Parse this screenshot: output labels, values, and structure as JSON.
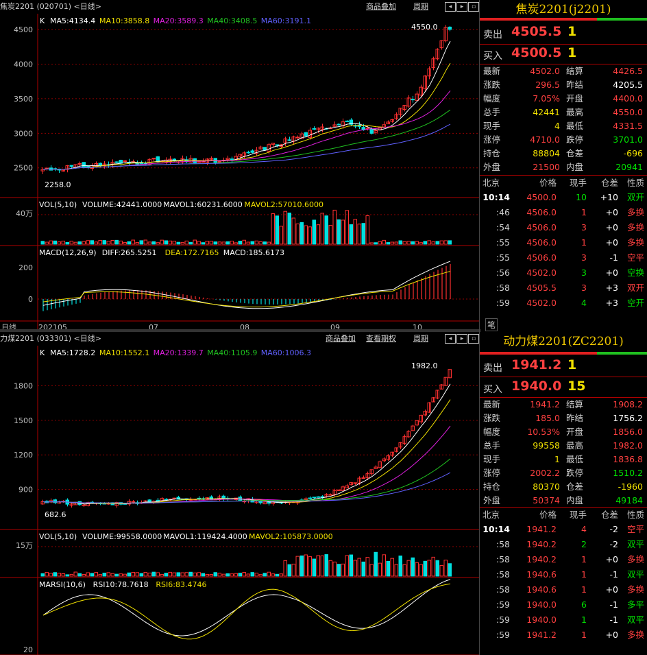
{
  "charts": [
    {
      "title": "焦炭2201 (020701) <日线>",
      "links": [
        "商品叠加",
        "周期"
      ],
      "k": {
        "label": "K",
        "ma5": "MA5:4134.4",
        "ma10": "MA10:3858.8",
        "ma20": "MA20:3589.3",
        "ma40": "MA40:3408.5",
        "ma60": "MA60:3191.1",
        "yticks": [
          "4500",
          "4000",
          "3500",
          "3000",
          "2500"
        ],
        "max_label": "4550.0",
        "min_label": "2258.0",
        "ymin": 2150,
        "ymax": 4650,
        "start": 2480,
        "end": 4550,
        "low": 2258,
        "high": 4550,
        "mamult": [
          0.97,
          0.92,
          0.86,
          0.8,
          0.75
        ]
      },
      "vol": {
        "label": "VOL(5,10)",
        "v": "VOLUME:42441.0000",
        "m1": "MAVOL1:60231.6000",
        "m2": "MAVOL2:57010.6000",
        "ytick": "40万"
      },
      "ind": {
        "label": "MACD(12,26,9)",
        "a": "DIFF:265.5251",
        "b": "DEA:172.7165",
        "c": "MACD:185.6173",
        "yticks": [
          "200",
          "0"
        ]
      },
      "dates": [
        "日线",
        "202105",
        "07",
        "08",
        "09",
        "10"
      ]
    },
    {
      "title": "力煤2201 (033301) <日线>",
      "links": [
        "商品叠加",
        "查看期权",
        "周期"
      ],
      "k": {
        "label": "K",
        "ma5": "MA5:1728.2",
        "ma10": "MA10:1552.1",
        "ma20": "MA20:1339.7",
        "ma40": "MA40:1105.9",
        "ma60": "MA60:1006.3",
        "yticks": [
          "1800",
          "1500",
          "1200",
          "900"
        ],
        "max_label": "1982.0",
        "min_label": "682.6",
        "ymin": 600,
        "ymax": 2100,
        "start": 800,
        "end": 1982,
        "low": 682.6,
        "high": 1982,
        "mamult": [
          0.95,
          0.85,
          0.74,
          0.62,
          0.56
        ]
      },
      "vol": {
        "label": "VOL(5,10)",
        "v": "VOLUME:99558.0000",
        "m1": "MAVOL1:119424.4000",
        "m2": "MAVOL2:105873.0000",
        "ytick": "15万"
      },
      "ind": {
        "label": "MARSI(10,6)",
        "a": "RSI10:78.7618",
        "b": "RSI6:83.4746",
        "c": "",
        "yticks": [
          "20"
        ]
      }
    }
  ],
  "panels": [
    {
      "title": "焦炭2201(j2201)",
      "sell": {
        "label": "卖出",
        "price": "4505.5",
        "vol": "1"
      },
      "buy": {
        "label": "买入",
        "price": "4500.5",
        "vol": "1"
      },
      "stats": [
        [
          "最新",
          "4502.0",
          "red",
          "结算",
          "4426.5",
          "red"
        ],
        [
          "涨跌",
          "296.5",
          "red",
          "昨结",
          "4205.5",
          "wht"
        ],
        [
          "幅度",
          "7.05%",
          "red",
          "开盘",
          "4400.0",
          "red"
        ],
        [
          "总手",
          "42441",
          "yel",
          "最高",
          "4550.0",
          "red"
        ],
        [
          "现手",
          "4",
          "yel",
          "最低",
          "4331.5",
          "red"
        ],
        [
          "涨停",
          "4710.0",
          "red",
          "跌停",
          "3701.0",
          "grn"
        ],
        [
          "持仓",
          "88804",
          "yel",
          "仓差",
          "-696",
          "yel"
        ],
        [
          "外盘",
          "21500",
          "red",
          "内盘",
          "20941",
          "grn"
        ]
      ],
      "header": [
        "北京",
        "价格",
        "现手",
        "仓差",
        "性质"
      ],
      "ticks": [
        [
          "10:14",
          "4500.0",
          "10",
          "grn",
          "+10",
          "双开",
          "grn"
        ],
        [
          ":46",
          "4506.0",
          "1",
          "red",
          "+0",
          "多换",
          "red"
        ],
        [
          ":54",
          "4506.0",
          "3",
          "red",
          "+0",
          "多换",
          "red"
        ],
        [
          ":55",
          "4506.0",
          "1",
          "red",
          "+0",
          "多换",
          "red"
        ],
        [
          ":55",
          "4506.0",
          "3",
          "red",
          "-1",
          "空平",
          "red"
        ],
        [
          ":56",
          "4502.0",
          "3",
          "grn",
          "+0",
          "空换",
          "grn"
        ],
        [
          ":58",
          "4505.5",
          "3",
          "red",
          "+3",
          "双开",
          "red"
        ],
        [
          ":59",
          "4502.0",
          "4",
          "grn",
          "+3",
          "空开",
          "grn"
        ]
      ],
      "footer": "笔"
    },
    {
      "title": "动力煤2201(ZC2201)",
      "sell": {
        "label": "卖出",
        "price": "1941.2",
        "vol": "1"
      },
      "buy": {
        "label": "买入",
        "price": "1940.0",
        "vol": "15"
      },
      "stats": [
        [
          "最新",
          "1941.2",
          "red",
          "结算",
          "1908.2",
          "red"
        ],
        [
          "涨跌",
          "185.0",
          "red",
          "昨结",
          "1756.2",
          "wht"
        ],
        [
          "幅度",
          "10.53%",
          "red",
          "开盘",
          "1856.0",
          "red"
        ],
        [
          "总手",
          "99558",
          "yel",
          "最高",
          "1982.0",
          "red"
        ],
        [
          "现手",
          "1",
          "yel",
          "最低",
          "1836.8",
          "red"
        ],
        [
          "涨停",
          "2002.2",
          "red",
          "跌停",
          "1510.2",
          "grn"
        ],
        [
          "持仓",
          "80370",
          "yel",
          "仓差",
          "-1960",
          "yel"
        ],
        [
          "外盘",
          "50374",
          "red",
          "内盘",
          "49184",
          "grn"
        ]
      ],
      "header": [
        "北京",
        "价格",
        "现手",
        "仓差",
        "性质"
      ],
      "ticks": [
        [
          "10:14",
          "1941.2",
          "4",
          "red",
          "-2",
          "空平",
          "red"
        ],
        [
          ":58",
          "1940.2",
          "2",
          "grn",
          "-2",
          "双平",
          "grn"
        ],
        [
          ":58",
          "1940.2",
          "1",
          "red",
          "+0",
          "多换",
          "red"
        ],
        [
          ":58",
          "1940.6",
          "1",
          "red",
          "-1",
          "双平",
          "grn"
        ],
        [
          ":58",
          "1940.6",
          "1",
          "red",
          "+0",
          "多换",
          "red"
        ],
        [
          ":59",
          "1940.0",
          "6",
          "grn",
          "-1",
          "多平",
          "grn"
        ],
        [
          ":59",
          "1940.0",
          "1",
          "grn",
          "-1",
          "双平",
          "grn"
        ],
        [
          ":59",
          "1941.2",
          "1",
          "red",
          "+0",
          "多换",
          "red"
        ]
      ]
    }
  ],
  "colors": {
    "up": "#ff3030",
    "down": "#00e0e0",
    "ma5": "#ffffff",
    "ma10": "#f0e000",
    "ma20": "#e020e0",
    "ma40": "#20c020",
    "ma60": "#6060ff",
    "grid": "#900000"
  }
}
